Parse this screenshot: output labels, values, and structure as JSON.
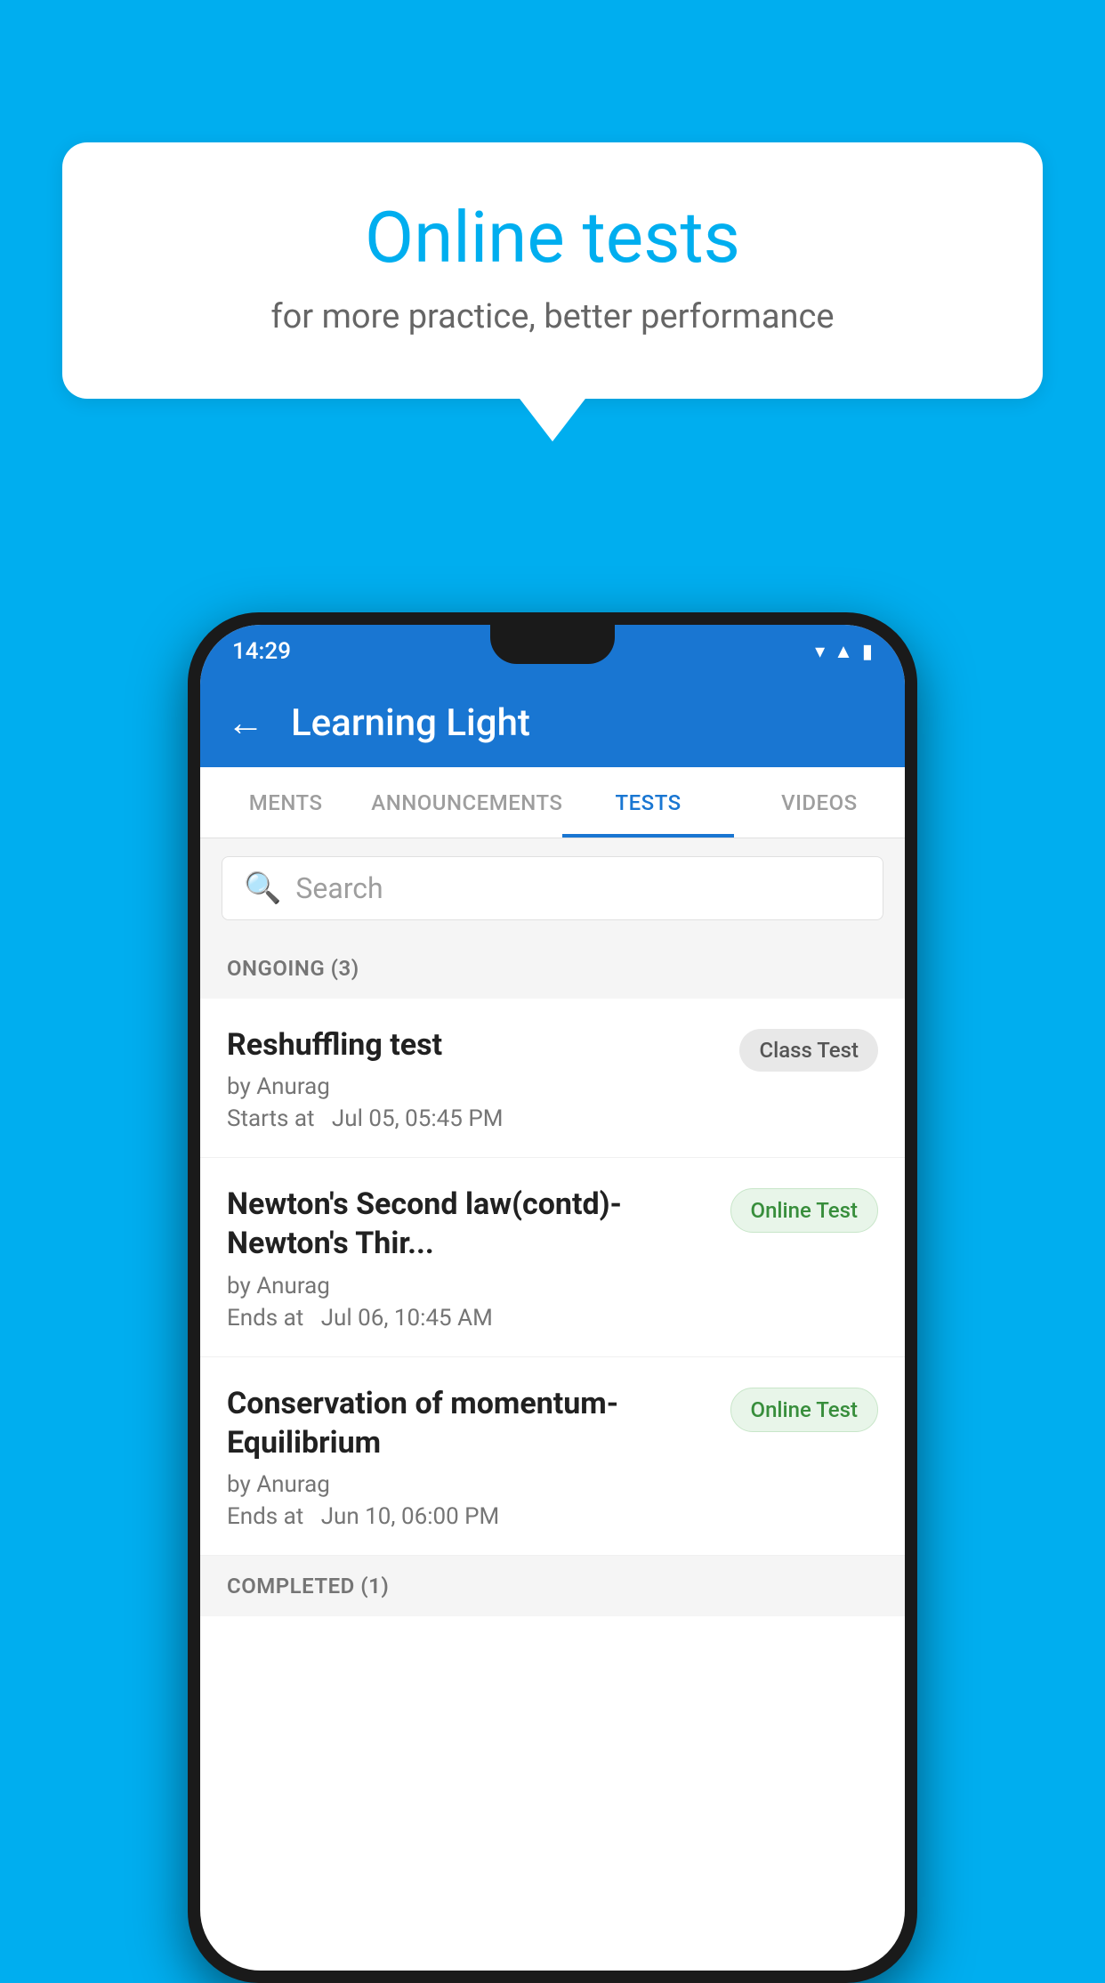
{
  "background": {
    "color": "#00AEEF"
  },
  "speech_bubble": {
    "title": "Online tests",
    "subtitle": "for more practice, better performance"
  },
  "status_bar": {
    "time": "14:29",
    "wifi_icon": "▼",
    "signal_icon": "▲",
    "battery_icon": "▮"
  },
  "app_bar": {
    "back_label": "←",
    "title": "Learning Light"
  },
  "tabs": [
    {
      "label": "MENTS",
      "active": false
    },
    {
      "label": "ANNOUNCEMENTS",
      "active": false
    },
    {
      "label": "TESTS",
      "active": true
    },
    {
      "label": "VIDEOS",
      "active": false
    }
  ],
  "search": {
    "placeholder": "Search"
  },
  "ongoing": {
    "header": "ONGOING (3)",
    "items": [
      {
        "title": "Reshuffling test",
        "author": "by Anurag",
        "time_label": "Starts at",
        "time": "Jul 05, 05:45 PM",
        "badge": "Class Test",
        "badge_type": "class"
      },
      {
        "title": "Newton's Second law(contd)-Newton's Thir...",
        "author": "by Anurag",
        "time_label": "Ends at",
        "time": "Jul 06, 10:45 AM",
        "badge": "Online Test",
        "badge_type": "online"
      },
      {
        "title": "Conservation of momentum-Equilibrium",
        "author": "by Anurag",
        "time_label": "Ends at",
        "time": "Jun 10, 06:00 PM",
        "badge": "Online Test",
        "badge_type": "online"
      }
    ]
  },
  "completed": {
    "header": "COMPLETED (1)"
  }
}
